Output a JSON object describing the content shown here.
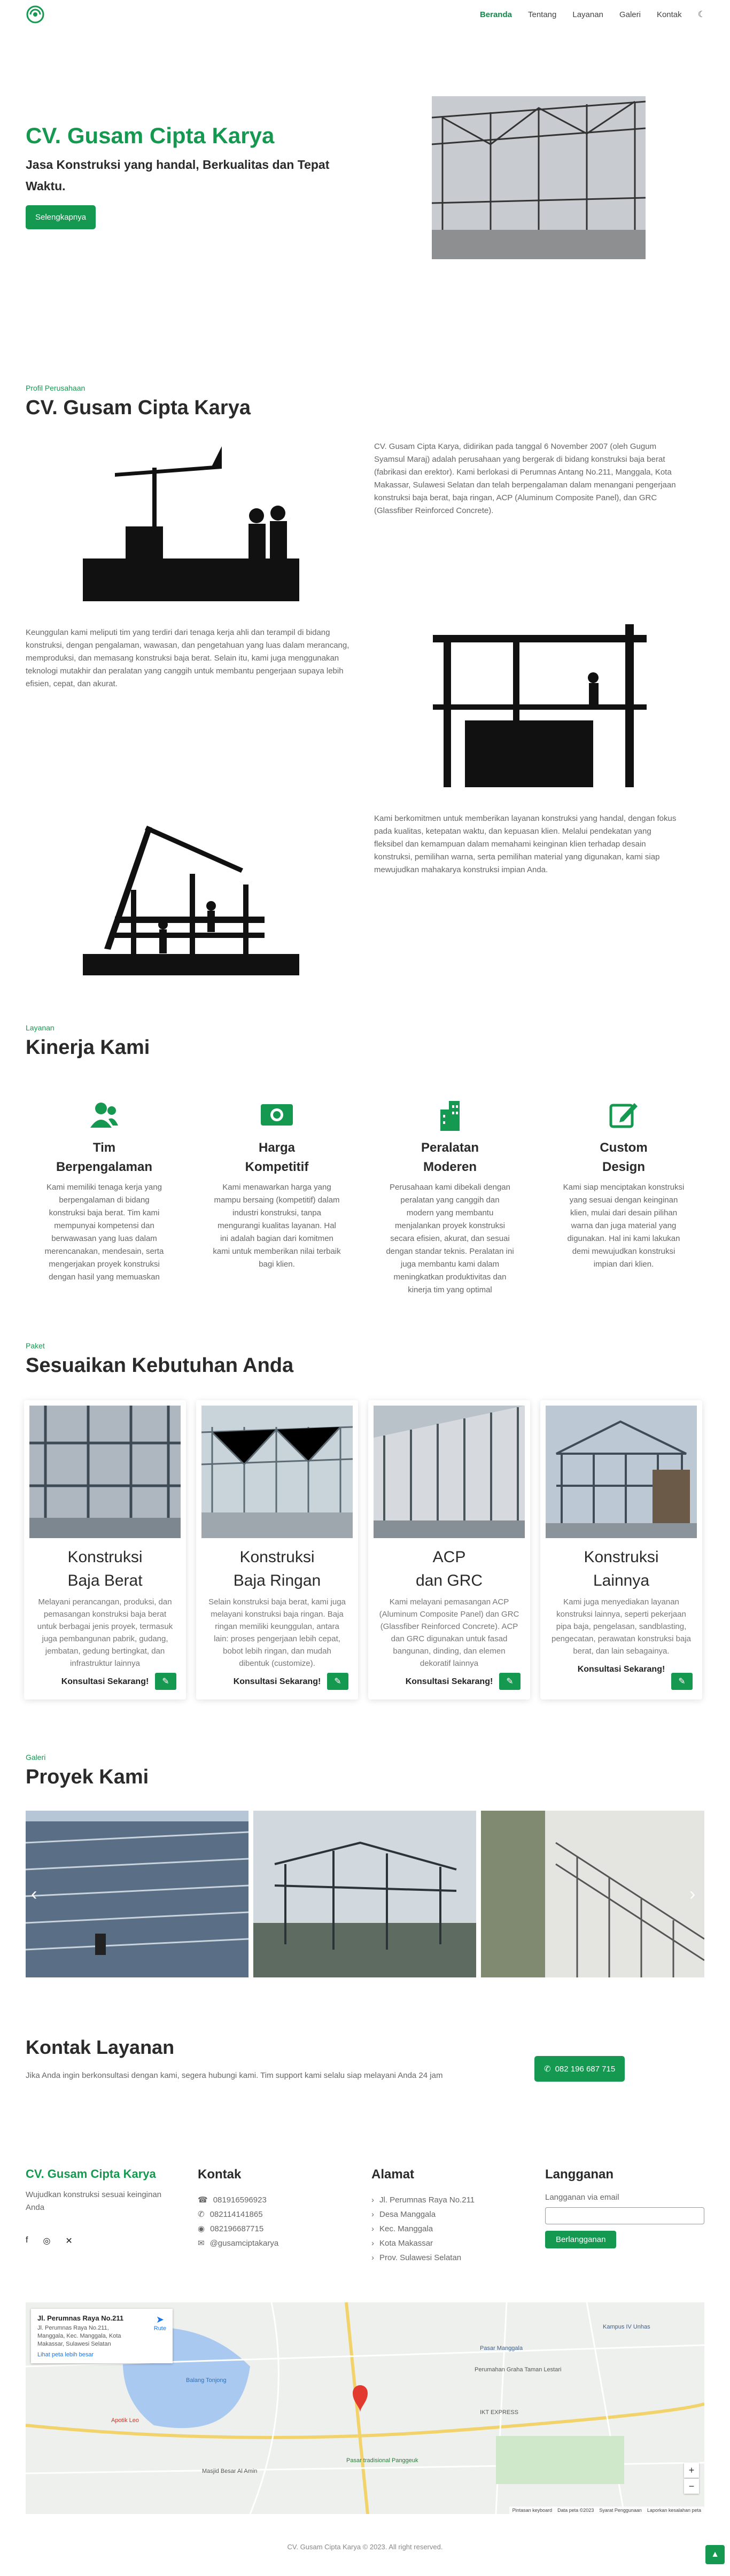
{
  "brand": {
    "accent": "#159950"
  },
  "nav": {
    "items": [
      "Beranda",
      "Tentang",
      "Layanan",
      "Galeri",
      "Kontak"
    ]
  },
  "hero": {
    "title": "CV. Gusam Cipta Karya",
    "subtitle": "Jasa Konstruksi yang handal, Berkualitas dan Tepat Waktu.",
    "button": "Selengkapnya"
  },
  "about": {
    "label": "Profil Perusahaan",
    "title": "CV. Gusam Cipta Karya",
    "p1": "CV. Gusam Cipta Karya, didirikan pada tanggal 6 November 2007 (oleh Gugum Syamsul Maraj) adalah perusahaan yang bergerak di bidang konstruksi baja berat (fabrikasi dan erektor). Kami berlokasi di Perumnas Antang No.211, Manggala, Kota Makassar, Sulawesi Selatan dan telah berpengalaman dalam menangani pengerjaan konstruksi baja berat, baja ringan, ACP (Aluminum Composite Panel), dan GRC (Glassfiber Reinforced Concrete).",
    "p2": "Keunggulan kami meliputi tim yang terdiri dari tenaga kerja ahli dan terampil di bidang konstruksi, dengan pengalaman, wawasan, dan pengetahuan yang luas dalam merancang, memproduksi, dan memasang konstruksi baja berat. Selain itu, kami juga menggunakan teknologi mutakhir dan peralatan yang canggih untuk membantu pengerjaan supaya lebih efisien, cepat, dan akurat.",
    "p3": "Kami berkomitmen untuk memberikan layanan konstruksi yang handal, dengan fokus pada kualitas, ketepatan waktu, dan kepuasan klien. Melalui pendekatan yang fleksibel dan kemampuan dalam memahami keinginan klien terhadap desain konstruksi, pemilihan warna, serta pemilihan material yang digunakan, kami siap mewujudkan mahakarya konstruksi impian Anda."
  },
  "kinerja": {
    "label": "Layanan",
    "title": "Kinerja Kami",
    "items": [
      {
        "l1": "Tim",
        "l2": "Berpengalaman",
        "desc": "Kami memiliki tenaga kerja yang berpengalaman di bidang konstruksi baja berat. Tim kami mempunyai kompetensi dan berwawasan yang luas dalam merencanakan, mendesain, serta mengerjakan proyek konstruksi dengan hasil yang memuaskan",
        "icon": "team-icon"
      },
      {
        "l1": "Harga",
        "l2": "Kompetitif",
        "desc": "Kami menawarkan harga yang mampu bersaing (kompetitif) dalam industri konstruksi, tanpa mengurangi kualitas layanan. Hal ini adalah bagian dari komitmen kami untuk memberikan nilai terbaik bagi klien.",
        "icon": "money-icon"
      },
      {
        "l1": "Peralatan",
        "l2": "Moderen",
        "desc": "Perusahaan kami dibekali dengan peralatan yang canggih dan modern yang membantu menjalankan proyek konstruksi secara efisien, akurat, dan sesuai dengan standar teknis. Peralatan ini juga membantu kami dalam meningkatkan produktivitas dan kinerja tim yang optimal",
        "icon": "building-icon"
      },
      {
        "l1": "Custom",
        "l2": "Design",
        "desc": "Kami siap menciptakan konstruksi yang sesuai dengan keinginan klien, mulai dari desain pilihan warna dan juga material yang digunakan. Hal ini kami lakukan demi mewujudkan konstruksi impian dari klien.",
        "icon": "edit-icon"
      }
    ]
  },
  "paket": {
    "label": "Paket",
    "title": "Sesuaikan Kebutuhan Anda",
    "items": [
      {
        "l1": "Konstruksi",
        "l2": "Baja Berat",
        "desc": "Melayani perancangan, produksi, dan pemasangan konstruksi baja berat untuk berbagai jenis proyek, termasuk juga pembangunan pabrik, gudang, jembatan, gedung bertingkat, dan infrastruktur lainnya",
        "cta": "Konsultasi Sekarang!"
      },
      {
        "l1": "Konstruksi",
        "l2": "Baja Ringan",
        "desc": "Selain konstruksi baja berat, kami juga melayani konstruksi baja ringan. Baja ringan memiliki keunggulan, antara lain: proses pengerjaan lebih cepat, bobot lebih ringan, dan mudah dibentuk (customize).",
        "cta": "Konsultasi Sekarang!"
      },
      {
        "l1": "ACP",
        "l2": "dan GRC",
        "desc": "Kami melayani pemasangan ACP (Aluminum Composite Panel) dan GRC (Glassfiber Reinforced Concrete). ACP dan GRC digunakan untuk fasad bangunan, dinding, dan elemen dekoratif lainnya",
        "cta": "Konsultasi Sekarang!"
      },
      {
        "l1": "Konstruksi",
        "l2": "Lainnya",
        "desc": "Kami juga menyediakan layanan konstruksi lainnya, seperti pekerjaan pipa baja, pengelasan, sandblasting, pengecatan, perawatan konstruksi baja berat, dan lain sebagainya.",
        "cta": "Konsultasi Sekarang!"
      }
    ]
  },
  "galeri": {
    "label": "Galeri",
    "title": "Proyek Kami"
  },
  "kontak": {
    "title": "Kontak Layanan",
    "desc": "Jika Anda ingin berkonsultasi dengan kami, segera hubungi kami. Tim support kami selalu siap melayani Anda 24 jam",
    "button": "082 196 687 715"
  },
  "footer": {
    "brand": "CV. Gusam Cipta Karya",
    "tagline": "Wujudkan konstruksi sesuai keinginan Anda",
    "kontak_title": "Kontak",
    "kontak": [
      "081916596923",
      "082114141865",
      "082196687715",
      "@gusamciptakarya"
    ],
    "alamat_title": "Alamat",
    "alamat": [
      "Jl. Perumnas Raya No.211",
      "Desa Manggala",
      "Kec. Manggala",
      "Kota Makassar",
      "Prov. Sulawesi Selatan"
    ],
    "langganan_title": "Langganan",
    "langganan_label": "Langganan via email",
    "langganan_button": "Berlangganan",
    "copyright": "CV. Gusam Cipta Karya © 2023. All right reserved."
  },
  "map": {
    "card_title": "Jl. Perumnas Raya No.211",
    "card_addr": "Jl. Perumnas Raya No.211, Manggala, Kec. Manggala, Kota Makassar, Sulawesi Selatan",
    "card_link": "Lihat peta lebih besar",
    "route": "Rute",
    "labels": [
      "Pasar Manggala",
      "Kampus IV Unhas",
      "Apotik Leo",
      "Balang Tonjong",
      "Masjid Besar Al Amin",
      "Perumahan Graha Taman Lestari",
      "IKT EXPRESS",
      "Pasar tradisional Panggeuk"
    ],
    "footer": [
      "Pintasan keyboard",
      "Data peta ©2023",
      "Syarat Penggunaan",
      "Laporkan kesalahan peta"
    ]
  }
}
